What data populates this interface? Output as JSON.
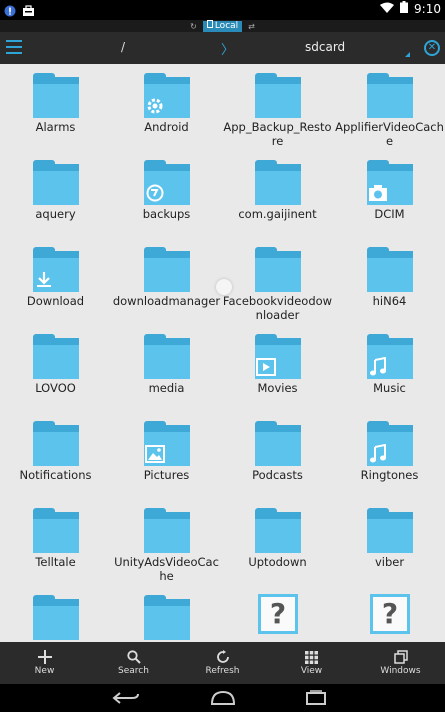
{
  "status": {
    "time": "9:10"
  },
  "location": {
    "tab_label": "Local"
  },
  "toolbar": {
    "path_root": "/",
    "path_separator": "〉",
    "current_folder": "sdcard"
  },
  "folders": [
    {
      "name": "Alarms",
      "badge": ""
    },
    {
      "name": "Android",
      "badge": "gear-icon"
    },
    {
      "name": "App_Backup_Restore",
      "badge": ""
    },
    {
      "name": "ApplifierVideoCache",
      "badge": ""
    },
    {
      "name": "aquery",
      "badge": ""
    },
    {
      "name": "backups",
      "badge": "backup-icon"
    },
    {
      "name": "com.gaijinent",
      "badge": ""
    },
    {
      "name": "DCIM",
      "badge": "camera-icon"
    },
    {
      "name": "Download",
      "badge": "download-icon"
    },
    {
      "name": "downloadmanager",
      "badge": ""
    },
    {
      "name": "Facebookvideodownloader",
      "badge": ""
    },
    {
      "name": "hiN64",
      "badge": ""
    },
    {
      "name": "LOVOO",
      "badge": ""
    },
    {
      "name": "media",
      "badge": ""
    },
    {
      "name": "Movies",
      "badge": "play-icon"
    },
    {
      "name": "Music",
      "badge": "music-note-icon"
    },
    {
      "name": "Notifications",
      "badge": ""
    },
    {
      "name": "Pictures",
      "badge": "picture-icon"
    },
    {
      "name": "Podcasts",
      "badge": ""
    },
    {
      "name": "Ringtones",
      "badge": "music-note-icon"
    },
    {
      "name": "Telltale",
      "badge": ""
    },
    {
      "name": "UnityAdsVideoCache",
      "badge": ""
    },
    {
      "name": "Uptodown",
      "badge": ""
    },
    {
      "name": "viber",
      "badge": ""
    },
    {
      "name": "",
      "badge": "",
      "type": "folder"
    },
    {
      "name": "",
      "badge": "",
      "type": "folder"
    },
    {
      "name": "",
      "badge": "",
      "type": "unknown",
      "glyph": "?"
    },
    {
      "name": "",
      "badge": "",
      "type": "unknown",
      "glyph": "?"
    }
  ],
  "bottom": {
    "new": "New",
    "search": "Search",
    "refresh": "Refresh",
    "view": "View",
    "windows": "Windows"
  },
  "colors": {
    "accent": "#2fa4d6",
    "folder_front": "#5cc3ec",
    "folder_back": "#3ea8d6",
    "toolbar": "#2b2b2b",
    "background": "#e9e9e9"
  }
}
